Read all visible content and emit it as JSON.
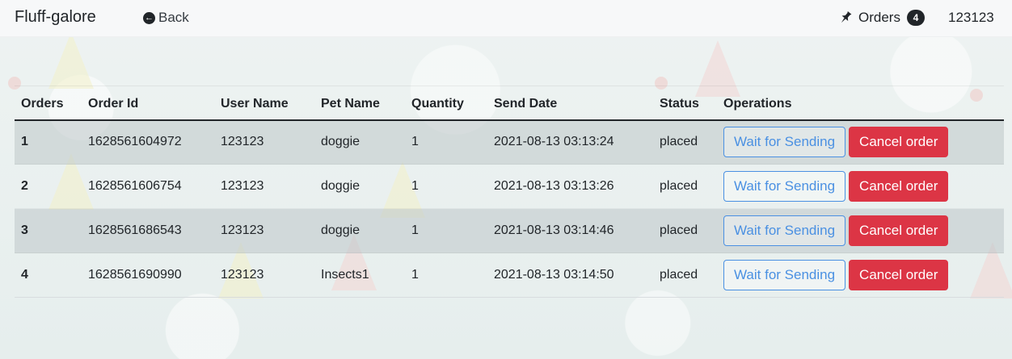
{
  "navbar": {
    "brand": "Fluff-galore",
    "back_label": "Back",
    "orders_label": "Orders",
    "orders_count": "4",
    "username": "123123"
  },
  "table": {
    "headers": [
      "Orders",
      "Order Id",
      "User Name",
      "Pet Name",
      "Quantity",
      "Send Date",
      "Status",
      "Operations"
    ],
    "rows": [
      {
        "num": "1",
        "order_id": "1628561604972",
        "user": "123123",
        "pet": "doggie",
        "qty": "1",
        "date": "2021-08-13 03:13:24",
        "status": "placed"
      },
      {
        "num": "2",
        "order_id": "1628561606754",
        "user": "123123",
        "pet": "doggie",
        "qty": "1",
        "date": "2021-08-13 03:13:26",
        "status": "placed"
      },
      {
        "num": "3",
        "order_id": "1628561686543",
        "user": "123123",
        "pet": "doggie",
        "qty": "1",
        "date": "2021-08-13 03:14:46",
        "status": "placed"
      },
      {
        "num": "4",
        "order_id": "1628561690990",
        "user": "123123",
        "pet": "Insects1",
        "qty": "1",
        "date": "2021-08-13 03:14:50",
        "status": "placed"
      }
    ],
    "wait_label": "Wait for Sending",
    "cancel_label": "Cancel order"
  },
  "colors": {
    "primary": "#4a90e2",
    "danger": "#dc3545",
    "dark": "#212529"
  },
  "icons": {
    "back": "arrow-left-circle-icon",
    "orders": "pin-icon"
  }
}
